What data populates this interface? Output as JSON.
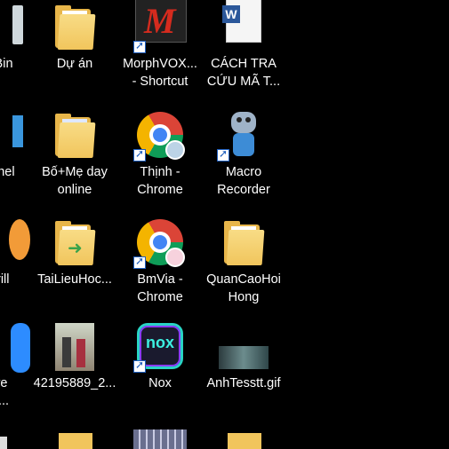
{
  "desktop": {
    "icons": [
      {
        "label": "e Bin"
      },
      {
        "label": "Dự án"
      },
      {
        "label": "MorphVOX...\n- Shortcut"
      },
      {
        "label": "CÁCH TRA\nCỨU MÃ T..."
      },
      {
        "label": "Panel"
      },
      {
        "label": "Bố+Mẹ day\nonline"
      },
      {
        "label": "Thịnh -\nChrome"
      },
      {
        "label": "Macro\nRecorder"
      },
      {
        "label": "Drill"
      },
      {
        "label": "TaiLieuHoc..."
      },
      {
        "label": "BmVia -\nChrome"
      },
      {
        "label": "QuanCaoHoi\nHong"
      },
      {
        "label": "ore\nn ..."
      },
      {
        "label": "42195889_2..."
      },
      {
        "label": "Nox"
      },
      {
        "label": "AnhTesstt.gif"
      }
    ]
  }
}
